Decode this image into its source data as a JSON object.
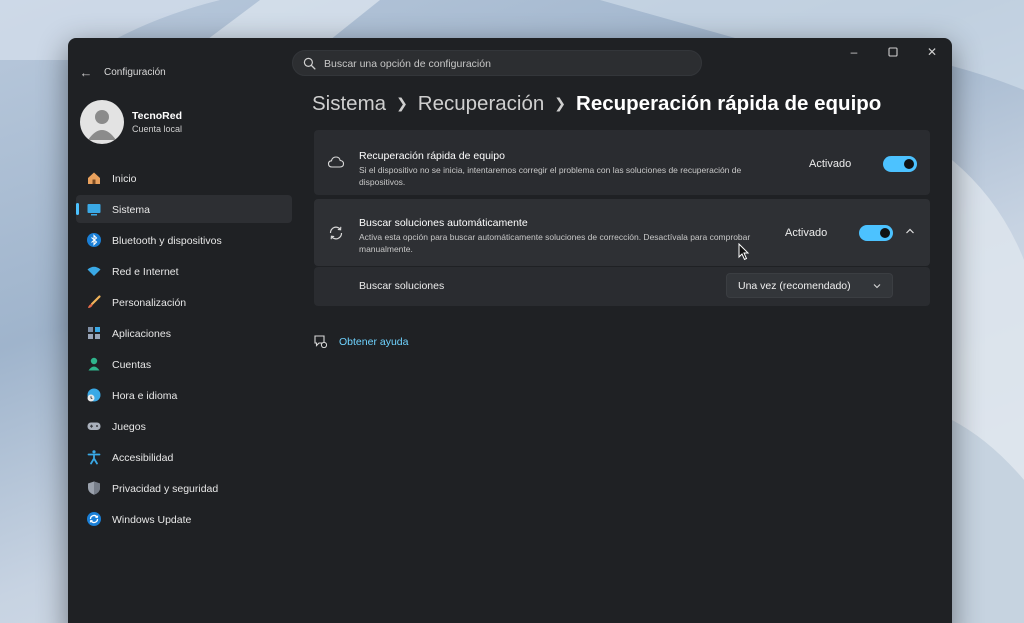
{
  "window": {
    "app_title": "Configuración",
    "back_icon": "back-arrow-icon"
  },
  "search": {
    "placeholder": "Buscar una opción de configuración"
  },
  "profile": {
    "name": "TecnoRed",
    "account_type": "Cuenta local"
  },
  "sidebar": {
    "items": [
      {
        "label": "Inicio",
        "icon": "home-icon",
        "active": false
      },
      {
        "label": "Sistema",
        "icon": "system-icon",
        "active": true
      },
      {
        "label": "Bluetooth y dispositivos",
        "icon": "bluetooth-icon",
        "active": false
      },
      {
        "label": "Red e Internet",
        "icon": "wifi-icon",
        "active": false
      },
      {
        "label": "Personalización",
        "icon": "brush-icon",
        "active": false
      },
      {
        "label": "Aplicaciones",
        "icon": "apps-icon",
        "active": false
      },
      {
        "label": "Cuentas",
        "icon": "account-icon",
        "active": false
      },
      {
        "label": "Hora e idioma",
        "icon": "time-language-icon",
        "active": false
      },
      {
        "label": "Juegos",
        "icon": "gamepad-icon",
        "active": false
      },
      {
        "label": "Accesibilidad",
        "icon": "accessibility-icon",
        "active": false
      },
      {
        "label": "Privacidad y seguridad",
        "icon": "shield-icon",
        "active": false
      },
      {
        "label": "Windows Update",
        "icon": "update-icon",
        "active": false
      }
    ]
  },
  "breadcrumb": {
    "items": [
      "Sistema",
      "Recuperación"
    ],
    "current": "Recuperación rápida de equipo"
  },
  "settings": {
    "quick_recovery": {
      "title": "Recuperación rápida de equipo",
      "description": "Si el dispositivo no se inicia, intentaremos corregir el problema con las soluciones de recuperación de dispositivos.",
      "state": "Activado",
      "on": true
    },
    "auto_search": {
      "title": "Buscar soluciones automáticamente",
      "description": "Activa esta opción para buscar automáticamente soluciones de corrección. Desactívala para comprobar manualmente.",
      "state": "Activado",
      "on": true,
      "expanded": true
    },
    "search_solutions": {
      "label": "Buscar soluciones",
      "value": "Una vez (recomendado)"
    }
  },
  "help": {
    "link": "Obtener ayuda"
  },
  "colors": {
    "accent": "#4cc2ff",
    "window_bg": "#1f2124",
    "card_bg": "#2a2c30",
    "link": "#6fd3ff"
  }
}
